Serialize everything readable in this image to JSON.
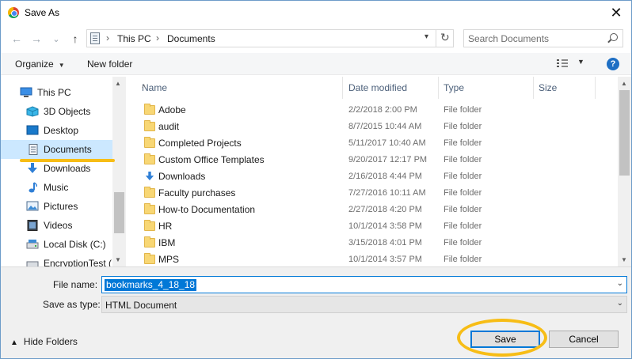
{
  "window": {
    "title": "Save As",
    "close_icon": "✕"
  },
  "nav": {
    "back_icon": "←",
    "forward_icon": "→",
    "history_icon": "⌄",
    "up_icon": "↑",
    "breadcrumb": [
      "This PC",
      "Documents"
    ],
    "crumb_sep": "›",
    "refresh_icon": "↻",
    "search_placeholder": "Search Documents"
  },
  "toolbar": {
    "organize_label": "Organize",
    "new_folder_label": "New folder",
    "help_label": "?"
  },
  "sidebar": {
    "items": [
      {
        "label": "This PC",
        "icon": "pc-icon"
      },
      {
        "label": "3D Objects",
        "icon": "cube-icon"
      },
      {
        "label": "Desktop",
        "icon": "desktop-icon"
      },
      {
        "label": "Documents",
        "icon": "document-icon",
        "selected": true
      },
      {
        "label": "Downloads",
        "icon": "download-icon"
      },
      {
        "label": "Music",
        "icon": "music-icon"
      },
      {
        "label": "Pictures",
        "icon": "picture-icon"
      },
      {
        "label": "Videos",
        "icon": "video-icon"
      },
      {
        "label": "Local Disk (C:)",
        "icon": "disk-icon"
      },
      {
        "label": "EncryptionTest (",
        "icon": "disk-icon"
      }
    ]
  },
  "columns": {
    "name": "Name",
    "date": "Date modified",
    "type": "Type",
    "size": "Size"
  },
  "files": [
    {
      "name": "Adobe",
      "date": "2/2/2018 2:00 PM",
      "type": "File folder",
      "icon": "folder-icon"
    },
    {
      "name": "audit",
      "date": "8/7/2015 10:44 AM",
      "type": "File folder",
      "icon": "folder-icon"
    },
    {
      "name": "Completed Projects",
      "date": "5/11/2017 10:40 AM",
      "type": "File folder",
      "icon": "folder-icon"
    },
    {
      "name": "Custom Office Templates",
      "date": "9/20/2017 12:17 PM",
      "type": "File folder",
      "icon": "folder-icon"
    },
    {
      "name": "Downloads",
      "date": "2/16/2018 4:44 PM",
      "type": "File folder",
      "icon": "download-icon"
    },
    {
      "name": "Faculty purchases",
      "date": "7/27/2016 10:11 AM",
      "type": "File folder",
      "icon": "folder-icon"
    },
    {
      "name": "How-to Documentation",
      "date": "2/27/2018 4:20 PM",
      "type": "File folder",
      "icon": "folder-icon"
    },
    {
      "name": "HR",
      "date": "10/1/2014 3:58 PM",
      "type": "File folder",
      "icon": "folder-icon"
    },
    {
      "name": "IBM",
      "date": "3/15/2018 4:01 PM",
      "type": "File folder",
      "icon": "folder-icon"
    },
    {
      "name": "MPS",
      "date": "10/1/2014 3:57 PM",
      "type": "File folder",
      "icon": "folder-icon"
    }
  ],
  "form": {
    "file_name_label": "File name:",
    "file_name_value": "bookmarks_4_18_18",
    "save_type_label": "Save as type:",
    "save_type_value": "HTML Document"
  },
  "footer": {
    "hide_folders_label": "Hide Folders",
    "save_label": "Save",
    "cancel_label": "Cancel"
  },
  "colors": {
    "accent": "#0078d7",
    "highlight": "#f7bd16",
    "selection": "#cce8ff",
    "folder": "#f8d775"
  }
}
